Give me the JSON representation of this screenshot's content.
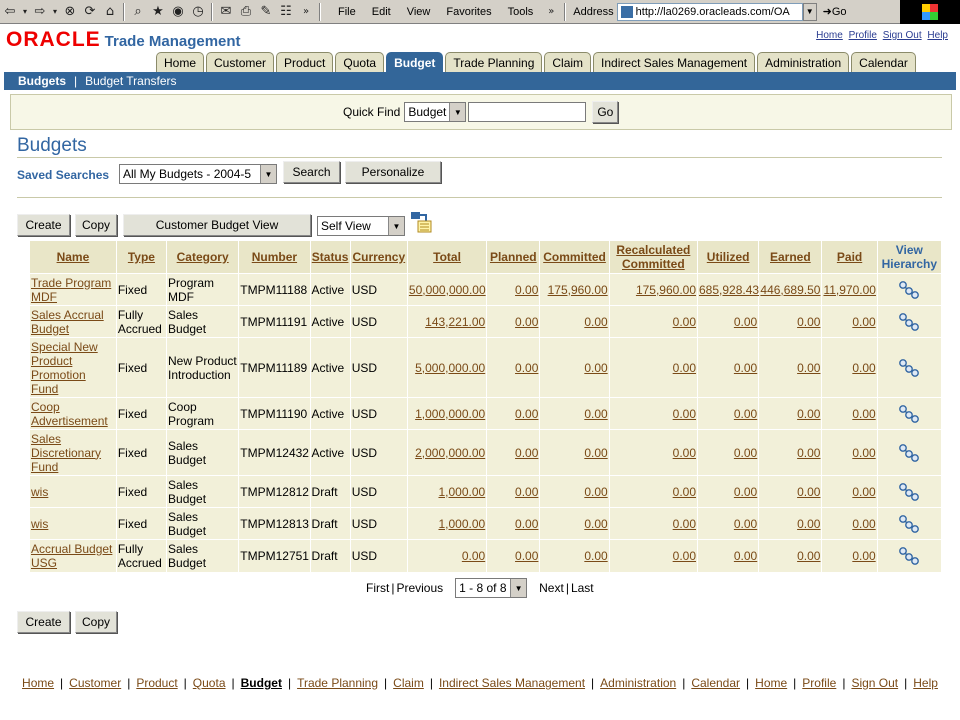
{
  "browser": {
    "menus": [
      "File",
      "Edit",
      "View",
      "Favorites",
      "Tools"
    ],
    "address_label": "Address",
    "address": "http://la0269.oracleads.com/OA",
    "go_label": "Go"
  },
  "brand": {
    "logo": "ORACLE",
    "app_name": "Trade Management"
  },
  "global_links": [
    "Home",
    "Profile",
    "Sign Out",
    "Help"
  ],
  "tabs": [
    {
      "label": "Home",
      "active": false
    },
    {
      "label": "Customer",
      "active": false
    },
    {
      "label": "Product",
      "active": false
    },
    {
      "label": "Quota",
      "active": false
    },
    {
      "label": "Budget",
      "active": true
    },
    {
      "label": "Trade Planning",
      "active": false
    },
    {
      "label": "Claim",
      "active": false
    },
    {
      "label": "Indirect Sales Management",
      "active": false
    },
    {
      "label": "Administration",
      "active": false
    },
    {
      "label": "Calendar",
      "active": false
    }
  ],
  "subnav": {
    "items": [
      "Budgets",
      "Budget Transfers"
    ]
  },
  "quick_find": {
    "label": "Quick Find",
    "selected": "Budget",
    "value": "",
    "go_label": "Go"
  },
  "page": {
    "title": "Budgets",
    "saved_searches_label": "Saved Searches",
    "saved_search_value": "All My Budgets - 2004-5",
    "search_label": "Search",
    "personalize_label": "Personalize"
  },
  "toolbar": {
    "create_label": "Create",
    "copy_label": "Copy",
    "customer_view_label": "Customer Budget View",
    "view_select": "Self View"
  },
  "table": {
    "headers": [
      "Name",
      "Type",
      "Category",
      "Number",
      "Status",
      "Currency",
      "Total",
      "Planned",
      "Committed",
      "Recalculated Committed",
      "Utilized",
      "Earned",
      "Paid",
      "View Hierarchy"
    ],
    "rows": [
      [
        "Trade Program MDF",
        "Fixed",
        "Program MDF",
        "TMPM11188",
        "Active",
        "USD",
        "50,000,000.00",
        "0.00",
        "175,960.00",
        "175,960.00",
        "685,928.43",
        "446,689.50",
        "11,970.00"
      ],
      [
        "Sales Accrual Budget",
        "Fully Accrued",
        "Sales Budget",
        "TMPM11191",
        "Active",
        "USD",
        "143,221.00",
        "0.00",
        "0.00",
        "0.00",
        "0.00",
        "0.00",
        "0.00"
      ],
      [
        "Special New Product Promotion Fund",
        "Fixed",
        "New Product Introduction",
        "TMPM11189",
        "Active",
        "USD",
        "5,000,000.00",
        "0.00",
        "0.00",
        "0.00",
        "0.00",
        "0.00",
        "0.00"
      ],
      [
        "Coop Advertisement",
        "Fixed",
        "Coop Program",
        "TMPM11190",
        "Active",
        "USD",
        "1,000,000.00",
        "0.00",
        "0.00",
        "0.00",
        "0.00",
        "0.00",
        "0.00"
      ],
      [
        "Sales Discretionary Fund",
        "Fixed",
        "Sales Budget",
        "TMPM12432",
        "Active",
        "USD",
        "2,000,000.00",
        "0.00",
        "0.00",
        "0.00",
        "0.00",
        "0.00",
        "0.00"
      ],
      [
        "wis",
        "Fixed",
        "Sales Budget",
        "TMPM12812",
        "Draft",
        "USD",
        "1,000.00",
        "0.00",
        "0.00",
        "0.00",
        "0.00",
        "0.00",
        "0.00"
      ],
      [
        "wis",
        "Fixed",
        "Sales Budget",
        "TMPM12813",
        "Draft",
        "USD",
        "1,000.00",
        "0.00",
        "0.00",
        "0.00",
        "0.00",
        "0.00",
        "0.00"
      ],
      [
        "Accrual Budget USG",
        "Fully Accrued",
        "Sales Budget",
        "TMPM12751",
        "Draft",
        "USD",
        "0.00",
        "0.00",
        "0.00",
        "0.00",
        "0.00",
        "0.00",
        "0.00"
      ]
    ]
  },
  "pager": {
    "first": "First",
    "previous": "Previous",
    "range": "1 - 8 of 8",
    "next": "Next",
    "last": "Last"
  },
  "footer": {
    "links": [
      "Home",
      "Customer",
      "Product",
      "Quota",
      "Budget",
      "Trade Planning",
      "Claim",
      "Indirect Sales Management",
      "Administration",
      "Calendar",
      "Home",
      "Profile",
      "Sign Out",
      "Help"
    ],
    "current": "Budget"
  },
  "colors": {
    "brand_red": "#e00000",
    "accent_blue": "#336699",
    "link_brown": "#7a4a17",
    "header_bg": "#e9e6c8",
    "row_bg": "#f2f0d9"
  },
  "icons": [
    "back-icon",
    "forward-icon",
    "stop-icon",
    "refresh-icon",
    "home-icon",
    "search-icon",
    "favorites-icon",
    "media-icon",
    "history-icon",
    "mail-icon",
    "print-icon",
    "edit-icon",
    "discuss-icon",
    "export-icon",
    "hierarchy-icon"
  ]
}
